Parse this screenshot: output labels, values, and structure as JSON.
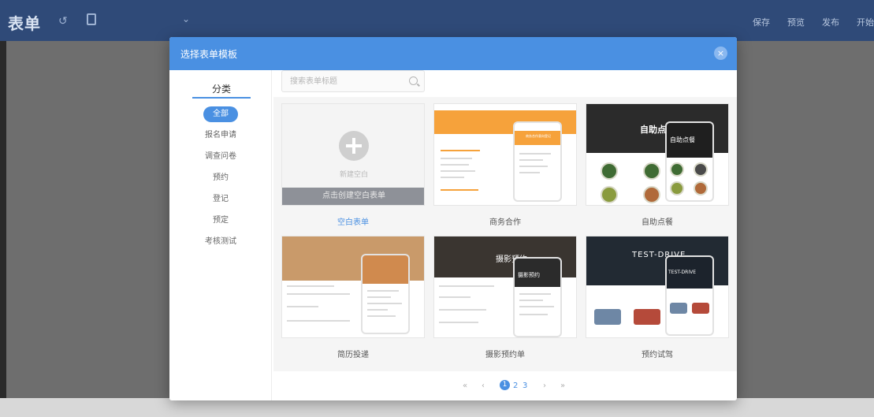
{
  "app": {
    "logo": "表单",
    "undo_glyph": "↺",
    "dropdown_glyph": "⌄",
    "actions": [
      "保存",
      "预览",
      "发布",
      "开始"
    ]
  },
  "modal": {
    "title": "选择表单模板",
    "close_glyph": "×",
    "sidebar": {
      "heading": "分类",
      "categories": [
        "全部",
        "报名申请",
        "调查问卷",
        "预约",
        "登记",
        "预定",
        "考核测试"
      ],
      "active_index": 0
    },
    "search": {
      "placeholder": "搜索表单标题"
    },
    "blank_card": {
      "caption": "新建空白",
      "action": "点击创建空白表单",
      "label": "空白表单"
    },
    "templates": [
      {
        "label": "商务合作",
        "preview_text": "商务合作意向登记"
      },
      {
        "label": "自助点餐",
        "preview_text": "自助点餐"
      },
      {
        "label": "简历投递",
        "preview_text": ""
      },
      {
        "label": "摄影预约单",
        "preview_text": "摄影预约"
      },
      {
        "label": "预约试驾",
        "preview_text": "TEST-DRIVE"
      }
    ],
    "pagination": {
      "first": "«",
      "prev": "‹",
      "pages": [
        "1",
        "2",
        "3"
      ],
      "current": "1",
      "next": "›",
      "last": "»"
    }
  },
  "colors": {
    "accent": "#4a90e2",
    "topbar": "#2f4a78",
    "blank_bar": "#8e9198",
    "business_orange": "#f6a23b"
  }
}
